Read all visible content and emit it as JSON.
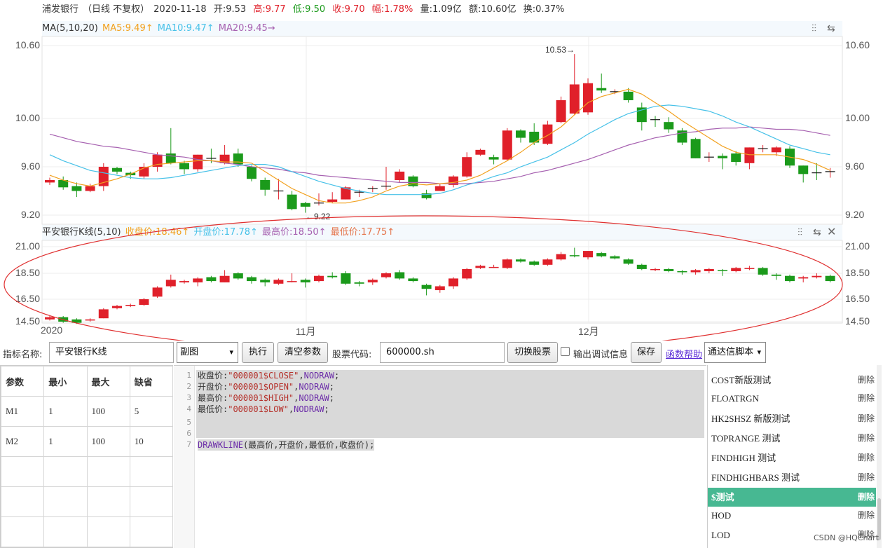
{
  "colors": {
    "up": "#e0202a",
    "down": "#1b9a1b",
    "ma5": "#f2a11f",
    "ma10": "#46c1e8",
    "ma20": "#a660b0",
    "grid": "#ececec",
    "annotation": "#e03030"
  },
  "header": {
    "name": "浦发银行",
    "period": "（日线 不复权）",
    "date": "2020-11-18",
    "open": "开:9.53",
    "high": "高:9.77",
    "low": "低:9.50",
    "close": "收:9.70",
    "change": "幅:1.78%",
    "volume": "量:1.09亿",
    "amount": "额:10.60亿",
    "turnover": "换:0.37%"
  },
  "main_panel": {
    "title": "MA(5,10,20)",
    "ma5": "MA5:9.49↑",
    "ma10": "MA10:9.47↑",
    "ma20": "MA20:9.45→",
    "yticks": [
      "10.60",
      "10.00",
      "9.60",
      "9.20"
    ],
    "high_marker": "10.53→",
    "low_marker": "←9.22"
  },
  "sub_panel": {
    "title": "平安银行K线(5,10)",
    "close": "收盘价:18.46↑",
    "open": "开盘价:17.78↑",
    "high": "最高价:18.50↑",
    "low": "最低价:17.75↑",
    "yticks": [
      "21.00",
      "18.50",
      "16.50",
      "14.50"
    ]
  },
  "xaxis": {
    "labels": [
      "2020",
      "11月",
      "12月"
    ]
  },
  "chart_data": [
    {
      "type": "candlestick",
      "title": "浦发银行",
      "ylim": [
        9.2,
        10.6
      ],
      "yticks": [
        9.2,
        9.6,
        10.0,
        10.6
      ],
      "candles": [
        [
          9.47,
          9.49,
          9.51,
          9.45
        ],
        [
          9.49,
          9.43,
          9.52,
          9.41
        ],
        [
          9.44,
          9.4,
          9.47,
          9.35
        ],
        [
          9.4,
          9.44,
          9.46,
          9.39
        ],
        [
          9.44,
          9.6,
          9.63,
          9.4
        ],
        [
          9.59,
          9.56,
          9.6,
          9.54
        ],
        [
          9.55,
          9.53,
          9.56,
          9.5
        ],
        [
          9.52,
          9.6,
          9.63,
          9.5
        ],
        [
          9.6,
          9.7,
          9.72,
          9.56
        ],
        [
          9.71,
          9.63,
          9.92,
          9.62
        ],
        [
          9.63,
          9.58,
          9.65,
          9.54
        ],
        [
          9.58,
          9.7,
          9.7,
          9.56
        ],
        [
          9.67,
          9.66,
          9.75,
          9.63
        ],
        [
          9.63,
          9.7,
          9.78,
          9.62
        ],
        [
          9.71,
          9.62,
          9.75,
          9.6
        ],
        [
          9.6,
          9.5,
          9.61,
          9.48
        ],
        [
          9.49,
          9.41,
          9.51,
          9.36
        ],
        [
          9.4,
          9.4,
          9.5,
          9.33
        ],
        [
          9.37,
          9.25,
          9.4,
          9.24
        ],
        [
          9.3,
          9.27,
          9.31,
          9.22
        ],
        [
          9.3,
          9.3,
          9.38,
          9.28
        ],
        [
          9.31,
          9.33,
          9.39,
          9.3
        ],
        [
          9.33,
          9.43,
          9.44,
          9.33
        ],
        [
          9.39,
          9.39,
          9.41,
          9.35
        ],
        [
          9.41,
          9.42,
          9.44,
          9.39
        ],
        [
          9.43,
          9.44,
          9.6,
          9.41
        ],
        [
          9.49,
          9.56,
          9.58,
          9.47
        ],
        [
          9.52,
          9.44,
          9.53,
          9.43
        ],
        [
          9.38,
          9.34,
          9.41,
          9.33
        ],
        [
          9.4,
          9.44,
          9.46,
          9.4
        ],
        [
          9.45,
          9.52,
          9.53,
          9.43
        ],
        [
          9.52,
          9.68,
          9.72,
          9.51
        ],
        [
          9.7,
          9.74,
          9.75,
          9.69
        ],
        [
          9.68,
          9.66,
          9.7,
          9.62
        ],
        [
          9.66,
          9.9,
          9.92,
          9.65
        ],
        [
          9.9,
          9.84,
          9.91,
          9.8
        ],
        [
          9.89,
          9.8,
          9.96,
          9.78
        ],
        [
          9.79,
          9.95,
          9.98,
          9.78
        ],
        [
          9.97,
          10.15,
          10.18,
          9.96
        ],
        [
          10.04,
          10.28,
          10.53,
          10.03
        ],
        [
          10.05,
          10.29,
          10.33,
          10.03
        ],
        [
          10.25,
          10.23,
          10.37,
          10.21
        ],
        [
          10.21,
          10.22,
          10.24,
          10.2
        ],
        [
          10.22,
          10.15,
          10.25,
          10.13
        ],
        [
          10.09,
          9.97,
          10.13,
          9.9
        ],
        [
          9.99,
          9.98,
          10.02,
          9.93
        ],
        [
          9.97,
          9.91,
          10.01,
          9.88
        ],
        [
          9.9,
          9.8,
          9.92,
          9.78
        ],
        [
          9.83,
          9.67,
          9.84,
          9.67
        ],
        [
          9.68,
          9.68,
          9.72,
          9.64
        ],
        [
          9.69,
          9.67,
          9.71,
          9.58
        ],
        [
          9.71,
          9.64,
          9.73,
          9.61
        ],
        [
          9.63,
          9.76,
          9.76,
          9.58
        ],
        [
          9.74,
          9.75,
          9.78,
          9.72
        ],
        [
          9.72,
          9.76,
          9.77,
          9.69
        ],
        [
          9.75,
          9.61,
          9.77,
          9.59
        ],
        [
          9.61,
          9.54,
          9.61,
          9.47
        ],
        [
          9.55,
          9.54,
          9.63,
          9.49
        ],
        [
          9.55,
          9.56,
          9.59,
          9.51
        ]
      ],
      "ma5": [
        9.53,
        9.49,
        9.46,
        9.44,
        9.47,
        9.5,
        9.54,
        9.59,
        9.62,
        9.63,
        9.64,
        9.65,
        9.65,
        9.64,
        9.64,
        9.63,
        9.56,
        9.49,
        9.42,
        9.37,
        9.32,
        9.3,
        9.3,
        9.32,
        9.35,
        9.4,
        9.44,
        9.46,
        9.45,
        9.46,
        9.47,
        9.49,
        9.53,
        9.59,
        9.65,
        9.72,
        9.8,
        9.86,
        9.93,
        10.03,
        10.13,
        10.18,
        10.21,
        10.24,
        10.2,
        10.13,
        10.06,
        9.98,
        9.91,
        9.84,
        9.77,
        9.72,
        9.7,
        9.7,
        9.7,
        9.68,
        9.66,
        9.62,
        9.57
      ],
      "ma10": [
        9.7,
        9.65,
        9.61,
        9.57,
        9.55,
        9.53,
        9.51,
        9.5,
        9.5,
        9.51,
        9.53,
        9.55,
        9.57,
        9.59,
        9.61,
        9.62,
        9.62,
        9.6,
        9.56,
        9.52,
        9.48,
        9.45,
        9.42,
        9.4,
        9.38,
        9.37,
        9.37,
        9.37,
        9.37,
        9.38,
        9.41,
        9.45,
        9.48,
        9.52,
        9.55,
        9.6,
        9.64,
        9.68,
        9.74,
        9.8,
        9.87,
        9.93,
        9.99,
        10.04,
        10.07,
        10.1,
        10.11,
        10.1,
        10.08,
        10.06,
        10.02,
        9.97,
        9.93,
        9.88,
        9.83,
        9.78,
        9.75,
        9.72,
        9.7
      ],
      "ma20": [
        9.87,
        9.84,
        9.81,
        9.79,
        9.77,
        9.76,
        9.74,
        9.72,
        9.7,
        9.69,
        9.68,
        9.66,
        9.65,
        9.63,
        9.62,
        9.6,
        9.59,
        9.58,
        9.56,
        9.55,
        9.53,
        9.52,
        9.51,
        9.5,
        9.49,
        9.48,
        9.47,
        9.47,
        9.47,
        9.46,
        9.46,
        9.46,
        9.47,
        9.48,
        9.5,
        9.52,
        9.55,
        9.57,
        9.6,
        9.63,
        9.66,
        9.7,
        9.74,
        9.78,
        9.81,
        9.84,
        9.86,
        9.88,
        9.89,
        9.91,
        9.92,
        9.92,
        9.93,
        9.92,
        9.91,
        9.91,
        9.9,
        9.88,
        9.86
      ]
    },
    {
      "type": "candlestick",
      "title": "平安银行K线(5,10)",
      "ylim": [
        14.5,
        21.0
      ],
      "candles": [
        [
          14.7,
          14.9,
          15.0,
          14.6
        ],
        [
          14.9,
          14.5,
          15.0,
          14.4
        ],
        [
          14.7,
          14.4,
          14.8,
          14.3
        ],
        [
          14.6,
          14.7,
          14.8,
          14.5
        ],
        [
          14.8,
          15.6,
          15.7,
          14.8
        ],
        [
          15.7,
          15.9,
          16.0,
          15.6
        ],
        [
          15.9,
          16.0,
          16.1,
          15.8
        ],
        [
          16.0,
          16.5,
          16.6,
          15.9
        ],
        [
          16.7,
          17.4,
          17.5,
          16.6
        ],
        [
          17.5,
          18.0,
          18.4,
          17.4
        ],
        [
          17.8,
          17.9,
          18.0,
          17.7
        ],
        [
          17.8,
          18.1,
          18.2,
          17.5
        ],
        [
          18.2,
          17.9,
          18.3,
          17.8
        ],
        [
          17.8,
          18.3,
          18.8,
          17.8
        ],
        [
          18.5,
          18.1,
          18.6,
          18.0
        ],
        [
          18.2,
          17.9,
          18.3,
          17.7
        ],
        [
          18.0,
          17.8,
          18.1,
          17.5
        ],
        [
          17.7,
          18.0,
          18.1,
          17.6
        ],
        [
          17.9,
          17.9,
          18.5,
          17.8
        ],
        [
          18.0,
          17.8,
          18.1,
          17.4
        ],
        [
          17.9,
          18.3,
          18.4,
          17.8
        ],
        [
          18.3,
          18.2,
          18.6,
          18.1
        ],
        [
          18.5,
          17.7,
          18.7,
          17.6
        ],
        [
          17.8,
          17.7,
          17.9,
          17.5
        ],
        [
          17.8,
          18.0,
          18.1,
          17.6
        ],
        [
          18.2,
          18.5,
          18.6,
          18.1
        ],
        [
          18.6,
          18.1,
          18.8,
          18.0
        ],
        [
          18.1,
          17.9,
          18.2,
          17.8
        ],
        [
          17.6,
          17.3,
          17.7,
          16.8
        ],
        [
          17.2,
          17.5,
          17.6,
          17.0
        ],
        [
          17.5,
          18.1,
          18.2,
          17.3
        ],
        [
          18.1,
          18.9,
          19.0,
          18.0
        ],
        [
          19.0,
          19.2,
          19.3,
          18.9
        ],
        [
          19.1,
          19.1,
          19.3,
          19.0
        ],
        [
          19.0,
          19.8,
          19.9,
          18.9
        ],
        [
          19.8,
          19.6,
          19.9,
          19.5
        ],
        [
          19.6,
          19.3,
          19.7,
          19.2
        ],
        [
          19.3,
          19.8,
          19.9,
          19.2
        ],
        [
          19.8,
          20.3,
          20.5,
          19.7
        ],
        [
          20.2,
          20.1,
          20.9,
          20.0
        ],
        [
          20.0,
          20.6,
          20.6,
          19.8
        ],
        [
          20.4,
          20.1,
          20.5,
          20.0
        ],
        [
          20.1,
          19.9,
          20.2,
          19.8
        ],
        [
          19.8,
          19.4,
          19.9,
          19.3
        ],
        [
          19.3,
          18.9,
          19.4,
          18.8
        ],
        [
          18.9,
          18.9,
          19.0,
          18.7
        ],
        [
          18.9,
          18.7,
          19.0,
          18.6
        ],
        [
          18.7,
          18.6,
          18.8,
          18.4
        ],
        [
          18.6,
          18.8,
          18.9,
          18.4
        ],
        [
          18.7,
          18.9,
          19.0,
          18.5
        ],
        [
          18.8,
          18.7,
          18.9,
          18.3
        ],
        [
          18.7,
          19.0,
          19.1,
          18.6
        ],
        [
          18.9,
          19.0,
          19.2,
          18.8
        ],
        [
          19.0,
          18.4,
          19.1,
          18.3
        ],
        [
          18.4,
          18.3,
          18.5,
          18.0
        ],
        [
          18.3,
          17.9,
          18.4,
          17.8
        ],
        [
          18.1,
          18.2,
          18.3,
          17.8
        ],
        [
          18.2,
          18.3,
          18.5,
          18.1
        ],
        [
          18.3,
          17.9,
          18.4,
          17.8
        ]
      ]
    }
  ],
  "formbar": {
    "indicator_label": "指标名称:",
    "indicator_value": "平安银行K线",
    "panel_select": "副图",
    "run": "执行",
    "clear": "清空参数",
    "code_label": "股票代码:",
    "code_value": "600000.sh",
    "switch": "切换股票",
    "debug": "输出调试信息",
    "save": "保存",
    "help": "函数帮助",
    "lang_select": "通达信脚本"
  },
  "params": {
    "headers": [
      "参数",
      "最小",
      "最大",
      "缺省"
    ],
    "rows": [
      [
        "M1",
        "1",
        "100",
        "5"
      ],
      [
        "M2",
        "1",
        "100",
        "10"
      ]
    ]
  },
  "editor": {
    "lines": [
      {
        "n": "1",
        "a": "收盘价:",
        "b": "\"000001$CLOSE\"",
        "c": ",",
        "d": "NODRAW",
        "e": ";"
      },
      {
        "n": "2",
        "a": "开盘价:",
        "b": "\"000001$OPEN\"",
        "c": ",",
        "d": "NODRAW",
        "e": ";"
      },
      {
        "n": "3",
        "a": "最高价:",
        "b": "\"000001$HIGH\"",
        "c": ",",
        "d": "NODRAW",
        "e": ";"
      },
      {
        "n": "4",
        "a": "最低价:",
        "b": "\"000001$LOW\"",
        "c": ",",
        "d": "NODRAW",
        "e": ";"
      }
    ],
    "line5": "5",
    "line6": "6",
    "line7": "7",
    "drawfn": "DRAWKLINE",
    "drawargs": "(最高价,开盘价,最低价,收盘价);"
  },
  "scripts": {
    "delete_label": "删除",
    "items": [
      "COST新版测试",
      "FLOATRGN",
      "HK2SHSZ 新版测试",
      "TOPRANGE 测试",
      "FINDHIGH 测试",
      "FINDHIGHBARS 测试",
      "$测试",
      "HOD",
      "LOD"
    ],
    "active_index": 6
  },
  "watermark": "CSDN @HQChart"
}
